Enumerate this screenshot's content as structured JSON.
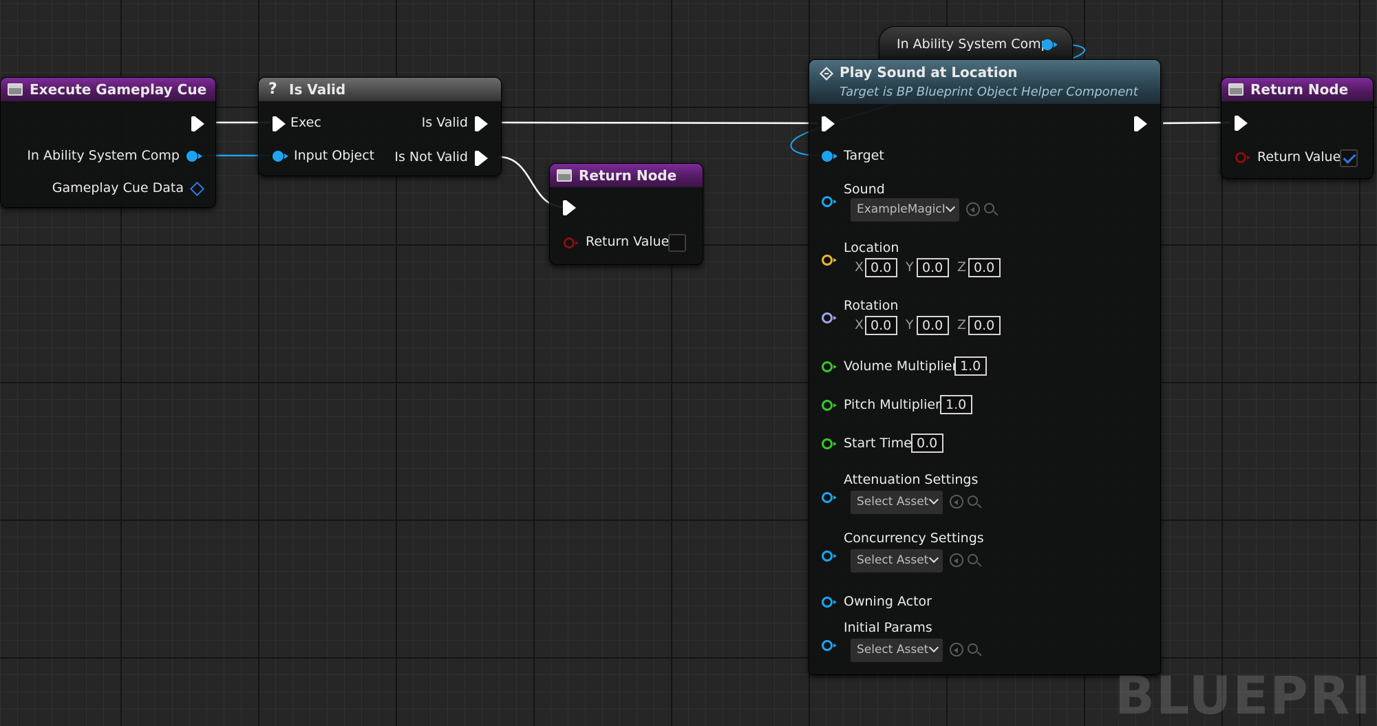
{
  "watermark": "BLUEPRINT",
  "colors": {
    "exec_pin": "#ffffff",
    "object_pin": "#1da3f0",
    "struct_pin": "#2b79e3",
    "bool_pin": "#8e0d0d",
    "vector_pin": "#e8b62f",
    "rotator_pin": "#9fa4e8",
    "float_pin": "#3ac52a",
    "event_header": "#5a1c6b",
    "pure_header": "#4a4a4a",
    "function_header": "#2d4654"
  },
  "execute_node": {
    "title": "Execute Gameplay Cue",
    "icon": "function-icon",
    "pins": {
      "ability_comp": "In Ability System Comp",
      "cue_data": "Gameplay Cue Data"
    }
  },
  "isvalid_node": {
    "title": "Is Valid",
    "icon": "question-mark-icon",
    "pins": {
      "exec": "Exec",
      "input": "Input Object",
      "valid": "Is Valid",
      "not_valid": "Is Not Valid"
    }
  },
  "return_node_1": {
    "title": "Return Node",
    "icon": "function-icon",
    "pins": {
      "return_value": "Return Value"
    },
    "return_checked": false
  },
  "getter_node": {
    "label": "In Ability System Comp"
  },
  "play_sound_node": {
    "title": "Play Sound at Location",
    "subtitle": "Target is BP Blueprint Object Helper Component",
    "icon": "function-diamond-icon",
    "pins": {
      "target": "Target",
      "sound": "Sound",
      "location": "Location",
      "rotation": "Rotation",
      "volume": "Volume Multiplier",
      "pitch": "Pitch Multiplier",
      "start_time": "Start Time",
      "attenuation": "Attenuation Settings",
      "concurrency": "Concurrency Settings",
      "owning_actor": "Owning Actor",
      "initial_params": "Initial Params"
    },
    "values": {
      "sound": "ExampleMagicI",
      "loc_x": "0.0",
      "loc_y": "0.0",
      "loc_z": "0.0",
      "rot_x": "0.0",
      "rot_y": "0.0",
      "rot_z": "0.0",
      "volume": "1.0",
      "pitch": "1.0",
      "start_time": "0.0",
      "attenuation": "Select Asset",
      "concurrency": "Select Asset",
      "initial_params": "Select Asset"
    },
    "axes": {
      "x": "X",
      "y": "Y",
      "z": "Z"
    }
  },
  "return_node_2": {
    "title": "Return Node",
    "icon": "function-icon",
    "pins": {
      "return_value": "Return Value"
    },
    "return_checked": true
  }
}
